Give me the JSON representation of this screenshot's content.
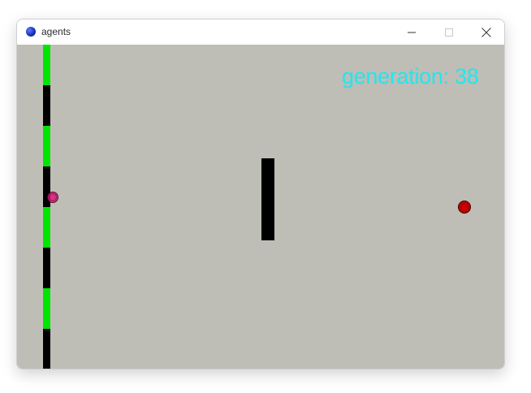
{
  "window": {
    "title": "agents",
    "app_icon": "blue-orb-icon"
  },
  "titlebar_controls": {
    "minimize_icon": "minimize-icon",
    "maximize_icon": "maximize-icon",
    "close_icon": "close-icon"
  },
  "game": {
    "generation_text": "generation: 38",
    "colors": {
      "background": "#bebdb6",
      "wall_green": "#00e600",
      "wall_black": "#000000",
      "obstacle": "#000000",
      "target": "#c00000",
      "agent": "#e0207f",
      "text": "#22e6f0"
    },
    "wall_segments": [
      "green",
      "black",
      "green",
      "black",
      "green",
      "black",
      "green",
      "black"
    ]
  }
}
